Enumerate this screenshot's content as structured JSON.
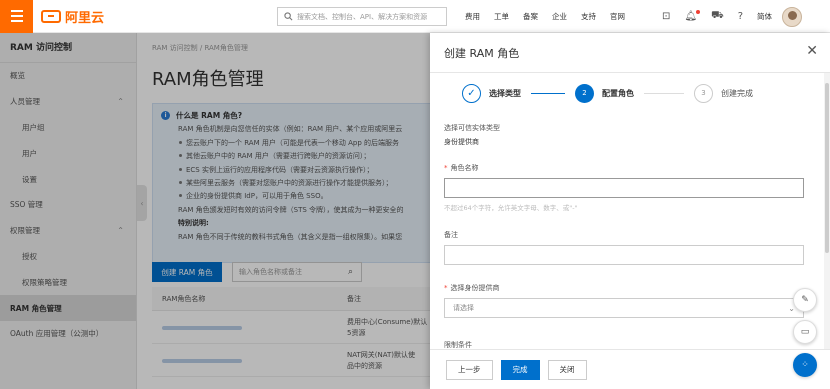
{
  "topbar": {
    "logo_text": "阿里云",
    "search_placeholder": "搜索文档、控制台、API、解决方案和资源",
    "nav": [
      "费用",
      "工单",
      "备案",
      "企业",
      "支持",
      "官网"
    ],
    "lang": "简体"
  },
  "sidebar": {
    "title": "RAM 访问控制",
    "items": [
      {
        "label": "概览",
        "sub": false
      },
      {
        "label": "人员管理",
        "sub": false,
        "chevron": "^"
      },
      {
        "label": "用户组",
        "sub": true
      },
      {
        "label": "用户",
        "sub": true
      },
      {
        "label": "设置",
        "sub": true
      },
      {
        "label": "SSO 管理",
        "sub": false
      },
      {
        "label": "权限管理",
        "sub": false,
        "chevron": "^"
      },
      {
        "label": "授权",
        "sub": true
      },
      {
        "label": "权限策略管理",
        "sub": true
      },
      {
        "label": "RAM 角色管理",
        "sub": false,
        "active": true
      },
      {
        "label": "OAuth 应用管理（公测中）",
        "sub": false
      }
    ]
  },
  "main": {
    "breadcrumb": "RAM 访问控制  /  RAM角色管理",
    "title": "RAM角色管理",
    "info": {
      "title": "什么是 RAM 角色?",
      "intro": "RAM 角色机制是向您信任的实体（例如：RAM 用户、某个应用或阿里云",
      "bullets": [
        "您云账户下的一个 RAM 用户（可能是代表一个移动 App 的后端服务",
        "其他云账户中的 RAM 用户（需要进行跨账户的资源访问）；",
        "ECS 实例上运行的应用程序代码（需要对云资源执行操作）；",
        "某些阿里云服务（需要对您账户中的资源进行操作才能提供服务）；",
        "企业的身份提供商 IdP，可以用于角色 SSO。"
      ],
      "line2": "RAM 角色颁发短时有效的访问令牌（STS 令牌），使其成为一种更安全的",
      "special_title": "特别说明:",
      "special": "RAM 角色不同于传统的教科书式角色（其含义是指一组权限集）。如果您"
    },
    "create_button": "创建 RAM 角色",
    "role_search_placeholder": "输入角色名称或备注",
    "table": {
      "headers": [
        "RAM角色名称",
        "备注"
      ],
      "rows": [
        {
          "note": "费用中心(Consume)默认\n5资源"
        },
        {
          "note": "NAT网关(NAT)默认使\n品中的资源"
        }
      ]
    }
  },
  "drawer": {
    "title": "创建 RAM 角色",
    "steps": [
      {
        "num": "✓",
        "label": "选择类型",
        "state": "done"
      },
      {
        "num": "2",
        "label": "配置角色",
        "state": "active"
      },
      {
        "num": "3",
        "label": "创建完成",
        "state": "todo"
      }
    ],
    "trusted_label": "选择可信实体类型",
    "trusted_value": "身份提供商",
    "role_name_label": "角色名称",
    "role_name_help": "不超过64个字符，允许英文字母、数字、或\"-\"",
    "remark_label": "备注",
    "idp_label": "选择身份提供商",
    "idp_placeholder": "请选择",
    "condition_label": "限制条件",
    "footer": {
      "prev": "上一步",
      "done": "完成",
      "close": "关闭"
    }
  }
}
